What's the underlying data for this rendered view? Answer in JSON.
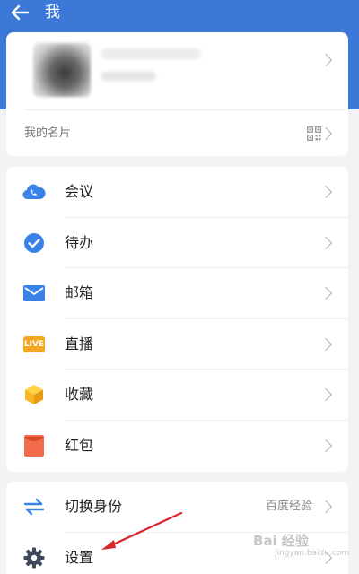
{
  "header": {
    "title": "我",
    "accent": "#3b78d8"
  },
  "profile": {
    "my_card_label": "我的名片",
    "qr_icon": "qr-code-icon"
  },
  "menu": {
    "items": [
      {
        "label": "会议",
        "icon": "meeting-cloud-icon",
        "color": "#3b82e8"
      },
      {
        "label": "待办",
        "icon": "todo-check-icon",
        "color": "#3b82e8"
      },
      {
        "label": "邮箱",
        "icon": "mail-icon",
        "color": "#3b82e8"
      },
      {
        "label": "直播",
        "icon": "live-icon",
        "color": "#f5a623",
        "badge": "LIVE"
      },
      {
        "label": "收藏",
        "icon": "favorites-cube-icon",
        "color": "#f5b623"
      },
      {
        "label": "红包",
        "icon": "red-envelope-icon",
        "color": "#f26b4a"
      }
    ]
  },
  "bottom": {
    "items": [
      {
        "label": "切换身份",
        "icon": "switch-identity-icon",
        "value": "百度经验"
      },
      {
        "label": "设置",
        "icon": "gear-icon"
      }
    ]
  },
  "watermark": {
    "brand": "Bai 经验",
    "sub": "jingyan.baidu.com"
  }
}
